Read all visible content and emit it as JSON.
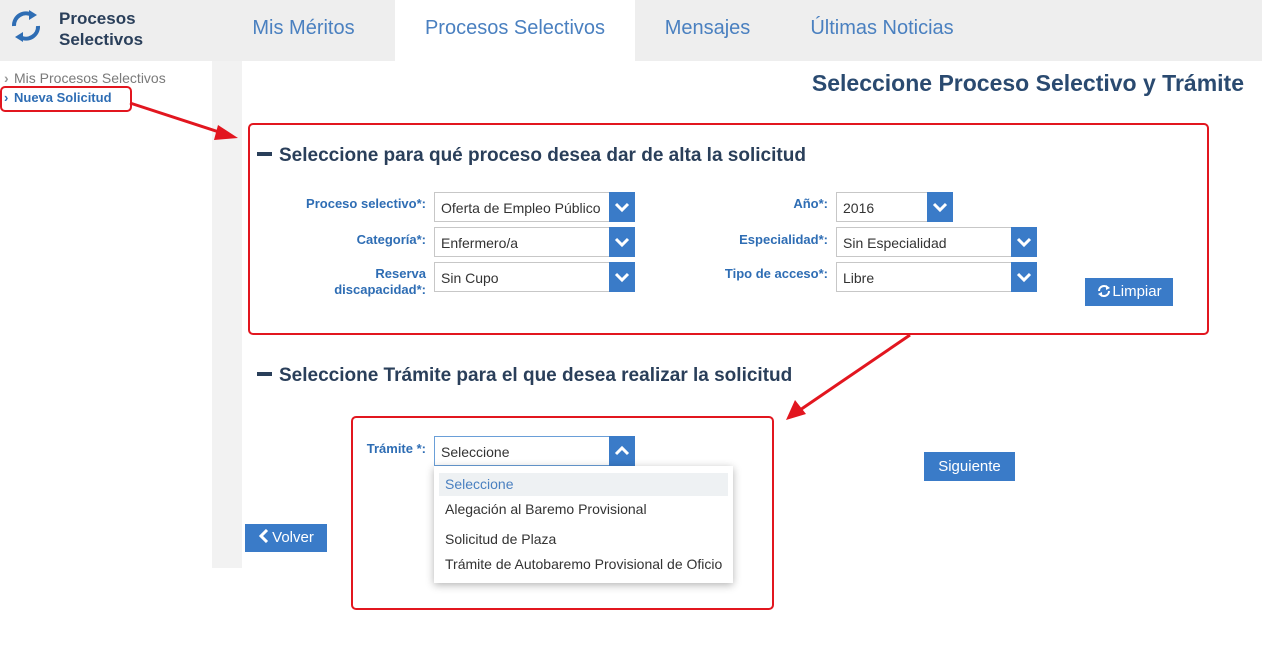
{
  "brand": {
    "line1": "Procesos",
    "line2": "Selectivos"
  },
  "nav": {
    "tabs": [
      {
        "label": "Mis Méritos"
      },
      {
        "label": "Procesos Selectivos"
      },
      {
        "label": "Mensajes"
      },
      {
        "label": "Últimas Noticias"
      }
    ],
    "active_tab": "Procesos Selectivos"
  },
  "sidebar": {
    "items": [
      {
        "label": "Mis Procesos Selectivos"
      },
      {
        "label": "Nueva Solicitud"
      }
    ],
    "active_item": "Nueva Solicitud"
  },
  "page": {
    "title": "Seleccione Proceso Selectivo y Trámite"
  },
  "section1": {
    "title": "Seleccione para qué proceso desea dar de alta la solicitud",
    "fields": {
      "proceso": {
        "label": "Proceso selectivo*:",
        "value": "Oferta de Empleo Público"
      },
      "categoria": {
        "label": "Categoría*:",
        "value": "Enfermero/a"
      },
      "reserva": {
        "label_line1": "Reserva",
        "label_line2": "discapacidad*:",
        "value": "Sin Cupo"
      },
      "anio": {
        "label": "Año*:",
        "value": "2016"
      },
      "especialidad": {
        "label": "Especialidad*:",
        "value": "Sin Especialidad"
      },
      "acceso": {
        "label": "Tipo de acceso*:",
        "value": "Libre"
      }
    },
    "clear_label": "Limpiar"
  },
  "section2": {
    "title": "Seleccione Trámite para el que desea realizar la solicitud",
    "tramite": {
      "label": "Trámite *:",
      "value": "Seleccione",
      "options": [
        "Seleccione",
        "Alegación al Baremo Provisional",
        "Solicitud de Plaza",
        "Trámite de Autobaremo Provisional de Oficio"
      ]
    },
    "next_label": "Siguiente"
  },
  "footer": {
    "back_label": "Volver"
  },
  "colors": {
    "accent": "#3a7bc8",
    "link": "#2e6db4",
    "title": "#2a4a70",
    "highlight": "#e2161f",
    "header_bg": "#eeeeee"
  }
}
